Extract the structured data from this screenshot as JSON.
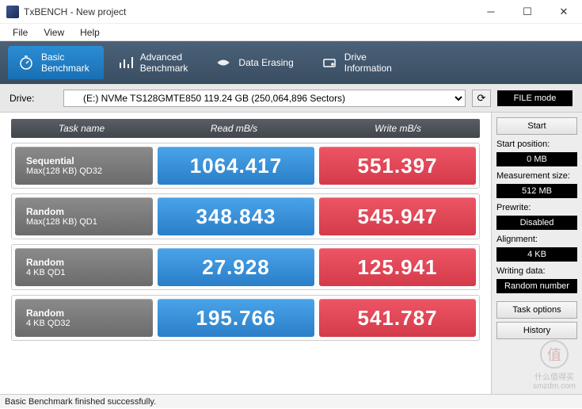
{
  "window": {
    "title": "TxBENCH - New project"
  },
  "menu": {
    "file": "File",
    "view": "View",
    "help": "Help"
  },
  "tabs": [
    {
      "line1": "Basic",
      "line2": "Benchmark"
    },
    {
      "line1": "Advanced",
      "line2": "Benchmark"
    },
    {
      "line1": "Data Erasing",
      "line2": ""
    },
    {
      "line1": "Drive",
      "line2": "Information"
    }
  ],
  "drive": {
    "label": "Drive:",
    "selected": "(E:) NVMe TS128GMTE850   119.24 GB (250,064,896 Sectors)",
    "mode": "FILE mode"
  },
  "headers": {
    "task": "Task name",
    "read": "Read mB/s",
    "write": "Write mB/s"
  },
  "rows": [
    {
      "t1": "Sequential",
      "t2": "Max(128 KB) QD32",
      "read": "1064.417",
      "write": "551.397"
    },
    {
      "t1": "Random",
      "t2": "Max(128 KB) QD1",
      "read": "348.843",
      "write": "545.947"
    },
    {
      "t1": "Random",
      "t2": "4 KB QD1",
      "read": "27.928",
      "write": "125.941"
    },
    {
      "t1": "Random",
      "t2": "4 KB QD32",
      "read": "195.766",
      "write": "541.787"
    }
  ],
  "side": {
    "start": "Start",
    "labels": {
      "pos": "Start position:",
      "size": "Measurement size:",
      "pre": "Prewrite:",
      "align": "Alignment:",
      "wdata": "Writing data:"
    },
    "values": {
      "pos": "0 MB",
      "size": "512 MB",
      "pre": "Disabled",
      "align": "4 KB",
      "wdata": "Random number"
    },
    "taskopt": "Task options",
    "history": "History"
  },
  "status": "Basic Benchmark finished successfully.",
  "watermark": "什么值得买\nsmzdm.com"
}
